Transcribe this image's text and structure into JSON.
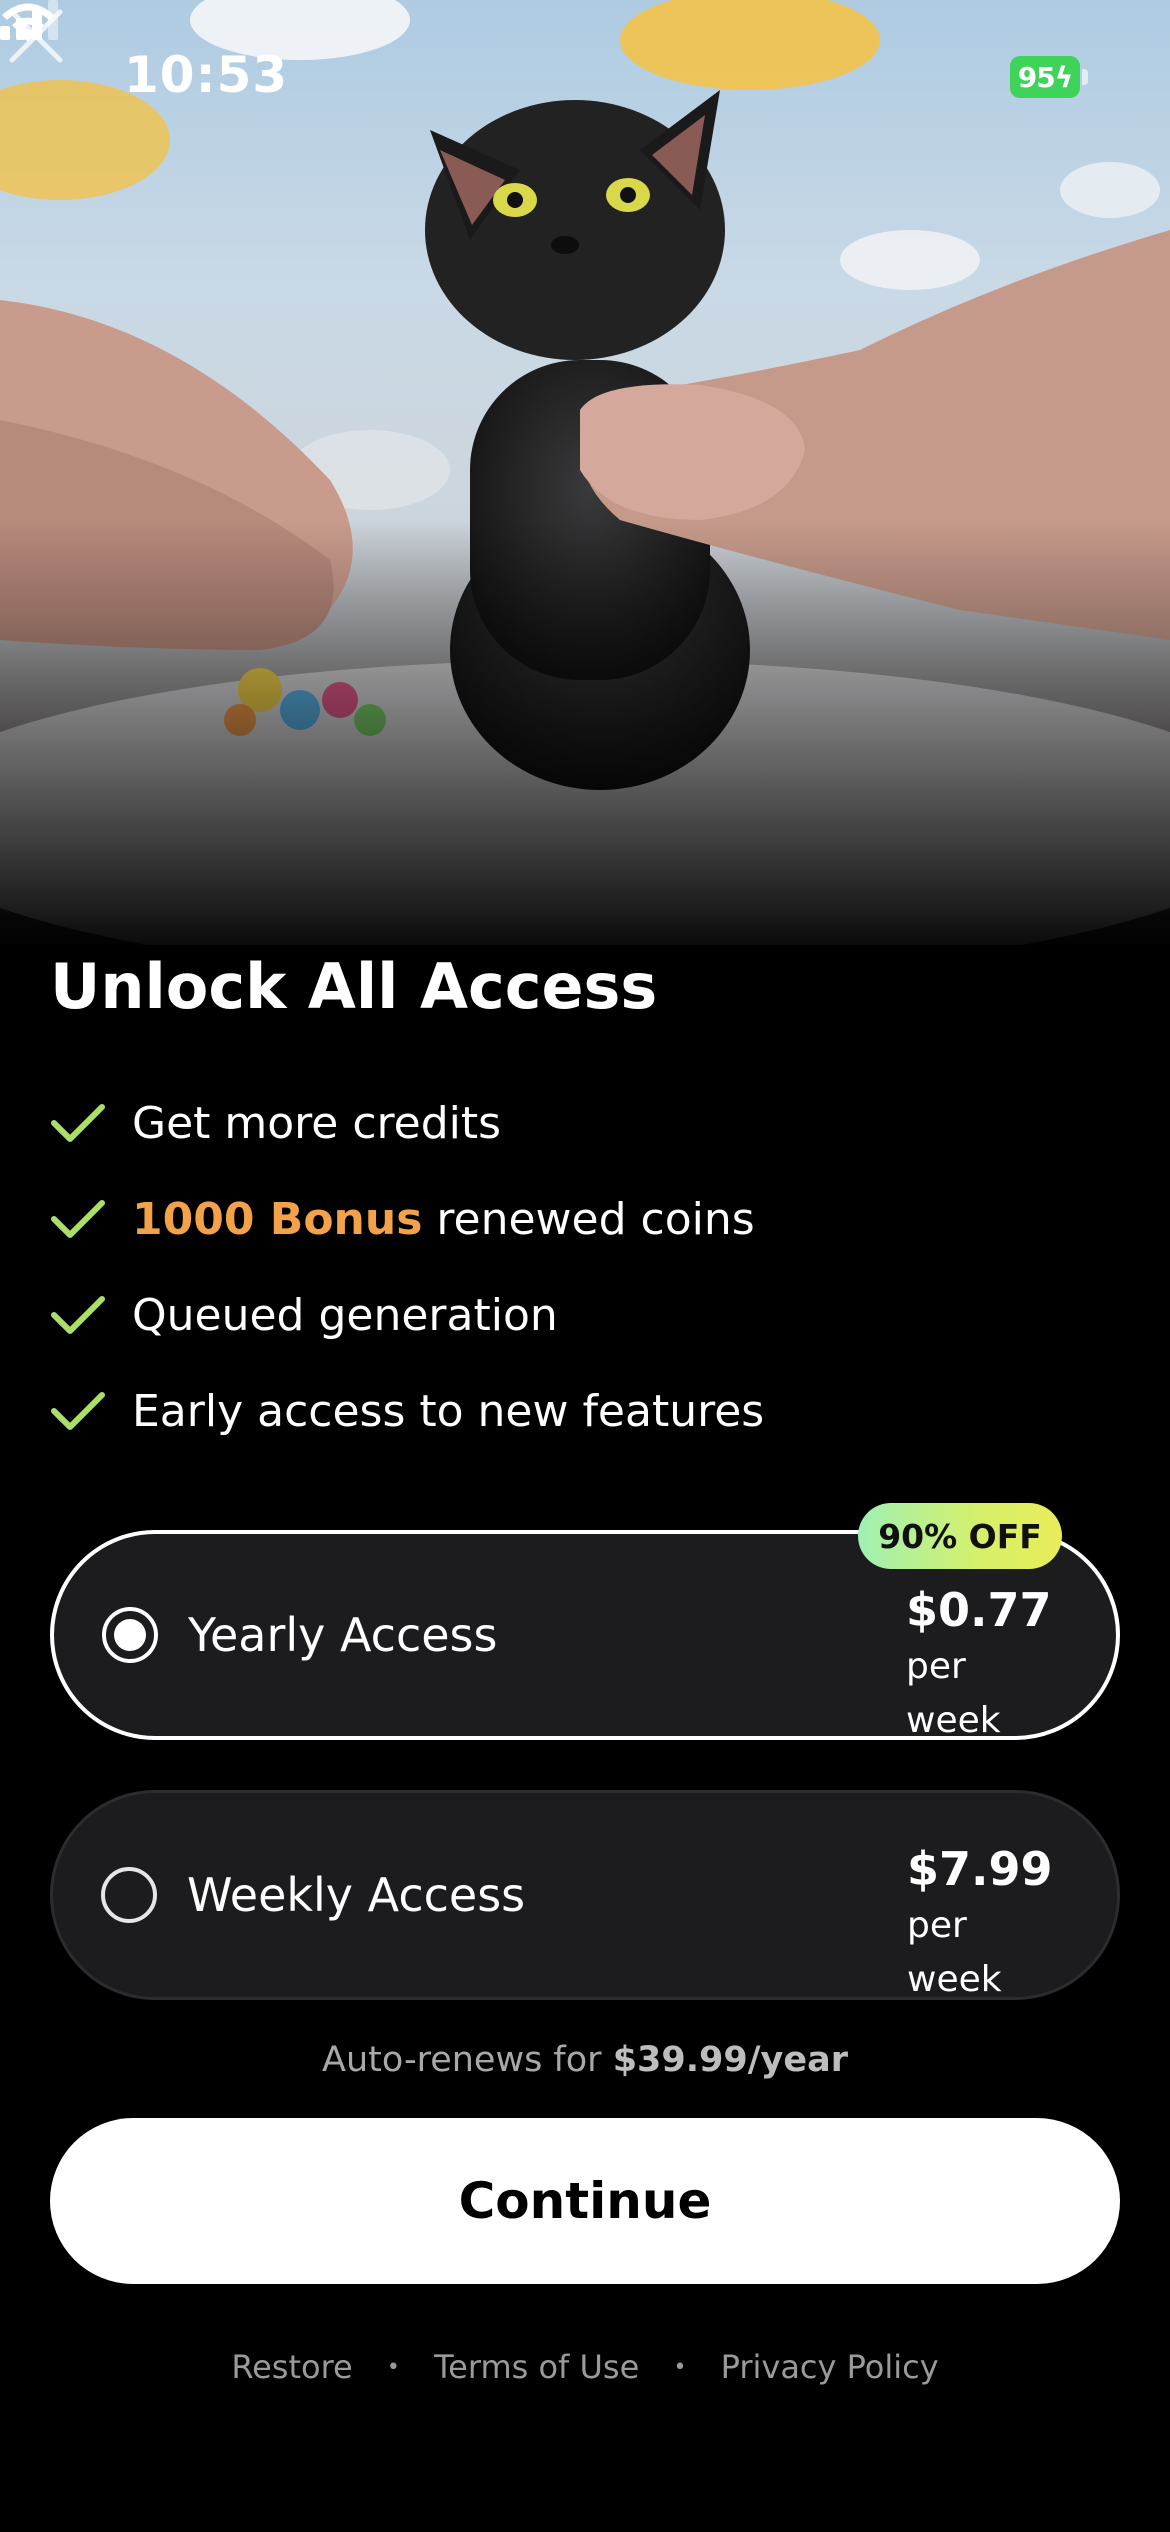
{
  "status_bar": {
    "time": "10:53",
    "battery_level": "95",
    "icons": [
      "signal-icon",
      "wifi-icon",
      "battery-charging-icon"
    ]
  },
  "hero": {
    "image_subject": "black cat figurine held between fingers against a sky backdrop",
    "close_icon": "close-icon"
  },
  "paywall": {
    "title": "Unlock All Access",
    "features": [
      {
        "text": "Get more credits"
      },
      {
        "highlight": "1000 Bonus",
        "text": " renewed coins"
      },
      {
        "text": "Queued generation"
      },
      {
        "text": "Early access to new features"
      }
    ],
    "plans": [
      {
        "name": "Yearly Access",
        "price": "$0.77",
        "unit": "per week",
        "selected": true,
        "badge": "90% OFF"
      },
      {
        "name": "Weekly Access",
        "price": "$7.99",
        "unit": "per week",
        "selected": false
      }
    ],
    "auto_renew_prefix": "Auto-renews for ",
    "auto_renew_price": "$39.99/year",
    "continue_label": "Continue",
    "footer_links": [
      "Restore",
      "Terms of Use",
      "Privacy Policy"
    ],
    "footer_separator": "•"
  },
  "colors": {
    "accent_check": "#a8e06a",
    "highlight": "#f4a24a",
    "badge_gradient_start": "#9ff0b4",
    "badge_gradient_end": "#e9ec58",
    "card_background": "#1c1c1e",
    "page_background": "#000000"
  }
}
